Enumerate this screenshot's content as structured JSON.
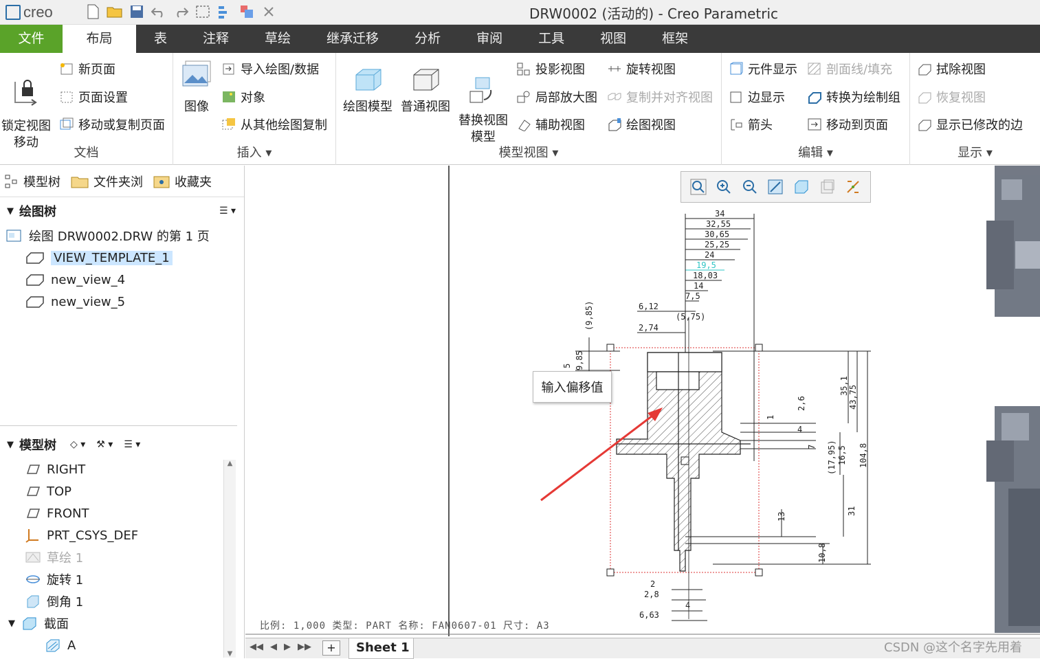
{
  "app": {
    "logo_text": "creo",
    "window_title": "DRW0002 (活动的) - Creo Parametric"
  },
  "tabs": [
    "文件",
    "布局",
    "表",
    "注释",
    "草绘",
    "继承迁移",
    "分析",
    "审阅",
    "工具",
    "视图",
    "框架"
  ],
  "ribbon": {
    "doc": {
      "lock": "锁定视图\n移动",
      "new_page": "新页面",
      "page_setup": "页面设置",
      "move_copy": "移动或复制页面",
      "label": "文档"
    },
    "insert": {
      "image": "图像",
      "import": "导入绘图/数据",
      "object": "对象",
      "copy_from": "从其他绘图复制",
      "label": "插入"
    },
    "model_views": {
      "drawing_model": "绘图模型",
      "general": "普通视图",
      "replace": "替换视图\n模型",
      "projection": "投影视图",
      "detail": "局部放大图",
      "auxiliary": "辅助视图",
      "revolved": "旋转视图",
      "copy_align": "复制并对齐视图",
      "drawing_view": "绘图视图",
      "label": "模型视图"
    },
    "edit": {
      "component": "元件显示",
      "hatch": "剖面线/填充",
      "edge": "边显示",
      "convert": "转换为绘制组",
      "arrow": "箭头",
      "move_page": "移动到页面",
      "label": "编辑"
    },
    "display": {
      "erase": "拭除视图",
      "restore": "恢复视图",
      "show_modified": "显示已修改的边",
      "label": "显示"
    }
  },
  "panel_tabs": [
    "模型树",
    "文件夹浏",
    "收藏夹"
  ],
  "drawing_tree": {
    "title": "绘图树",
    "root": "绘图 DRW0002.DRW 的第 1 页",
    "views": [
      "VIEW_TEMPLATE_1",
      "new_view_4",
      "new_view_5"
    ]
  },
  "model_tree": {
    "title": "模型树",
    "items": [
      "RIGHT",
      "TOP",
      "FRONT",
      "PRT_CSYS_DEF",
      "草绘 1",
      "旋转 1",
      "倒角 1",
      "截面",
      "A"
    ]
  },
  "dims": {
    "top": [
      "34",
      "32,55",
      "30,65",
      "25,25",
      "24",
      "19,5",
      "18,03",
      "14",
      "7,5",
      "(5,75)"
    ],
    "left": [
      "6,12",
      "2,74",
      "(9,85)",
      "5",
      "9,85"
    ],
    "right": [
      "35,1",
      "43,75",
      "2,6",
      "1",
      "4",
      "7",
      "(17,95)",
      "16,5",
      "104,8",
      "13",
      "31",
      "10,8"
    ],
    "bottom": [
      "2",
      "2,8",
      "4",
      "6,63"
    ]
  },
  "info_line": "比例: 1,000   类型: PART   名称: FAN0607-01   尺寸: A3",
  "tooltip": "输入偏移值",
  "sheet": "Sheet 1",
  "watermark": "CSDN @这个名字先用着",
  "colors": {
    "file_tab": "#5aa329",
    "tab_bar": "#3a3a3a",
    "selection": "#cce6ff",
    "dim_highlight": "#2ec4c4",
    "arrow": "#e53935"
  }
}
